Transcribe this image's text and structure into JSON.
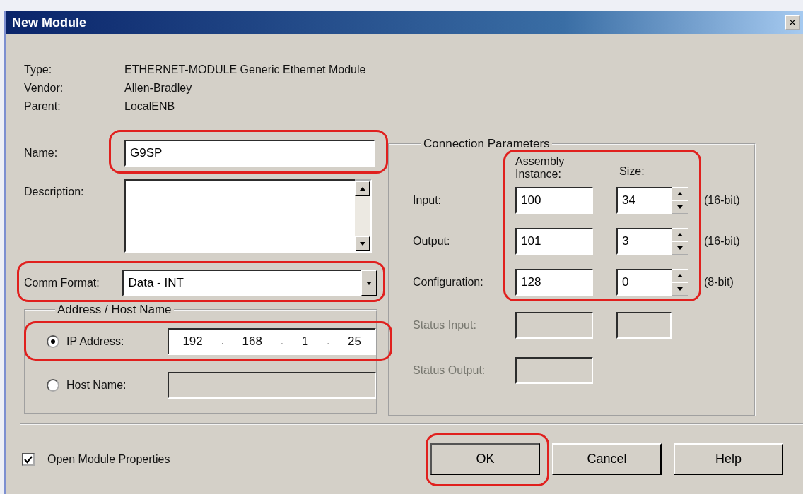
{
  "window": {
    "title": "New Module",
    "close_label": "×"
  },
  "info": [
    {
      "label": "Type:",
      "value": "ETHERNET-MODULE Generic Ethernet Module"
    },
    {
      "label": "Vendor:",
      "value": "Allen-Bradley"
    },
    {
      "label": "Parent:",
      "value": "LocalENB"
    }
  ],
  "name_field": {
    "label": "Name:",
    "value": "G9SP",
    "highlighted": true
  },
  "description": {
    "label": "Description:"
  },
  "comm_format": {
    "label": "Comm Format:",
    "value": "Data - INT",
    "highlighted": true
  },
  "address": {
    "title": "Address / Host Name",
    "options": [
      {
        "kind": "ip",
        "label": "IP Address:",
        "selected": true,
        "highlighted": true,
        "octets": [
          "192",
          "168",
          "1",
          "25"
        ],
        "separator": "."
      },
      {
        "kind": "host",
        "label": "Host Name:",
        "selected": false,
        "highlighted": false
      }
    ]
  },
  "connection_parameters": {
    "title": "Connection Parameters",
    "highlighted": true,
    "instance_header": "Assembly Instance:",
    "size_header": "Size:",
    "rows": [
      {
        "kind": "param",
        "label": "Input:",
        "instance": "100",
        "size": "34",
        "unit": "(16-bit)",
        "disabled": false
      },
      {
        "kind": "param",
        "label": "Output:",
        "instance": "101",
        "size": "3",
        "unit": "(16-bit)",
        "disabled": false
      },
      {
        "kind": "param",
        "label": "Configuration:",
        "instance": "128",
        "size": "0",
        "unit": "(8-bit)",
        "disabled": false
      },
      {
        "kind": "status",
        "label": "Status Input:",
        "has_size": true,
        "disabled": true
      },
      {
        "kind": "status",
        "label": "Status Output:",
        "has_size": false,
        "disabled": true
      }
    ]
  },
  "open_module_properties": {
    "label": "Open Module Properties",
    "checked": true
  },
  "buttons": [
    {
      "label": "OK",
      "highlighted": true
    },
    {
      "label": "Cancel",
      "highlighted": false
    },
    {
      "label": "Help",
      "highlighted": false
    }
  ]
}
